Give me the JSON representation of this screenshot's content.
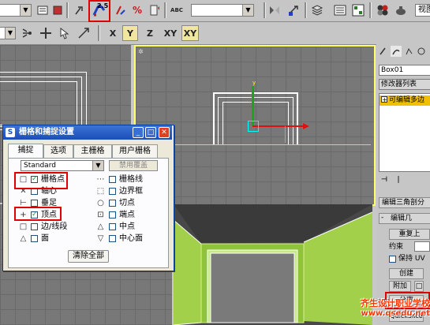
{
  "toolbar1": {
    "view_dropdown": "视图",
    "view_dropdown2": "视图",
    "snap_label": "2.5",
    "angle_snap": "A",
    "percent_snap": "%",
    "abc_label": "ABC"
  },
  "toolbar2": {
    "x_label": "X",
    "y_label": "Y",
    "z_label": "Z",
    "xy_label": "XY",
    "xy2_label": "XY"
  },
  "viewport": {
    "top_left_label": "",
    "perspective_label": ""
  },
  "dialog": {
    "title": "栅格和捕捉设置",
    "tabs": [
      "捕捉",
      "选项",
      "主栅格",
      "用户栅格"
    ],
    "preset": "Standard",
    "override_button": "禁用覆盖",
    "left_options": [
      {
        "label": "栅格点",
        "checked": true
      },
      {
        "label": "轴心",
        "checked": false
      },
      {
        "label": "垂足",
        "checked": false
      },
      {
        "label": "顶点",
        "checked": true
      },
      {
        "label": "边/线段",
        "checked": false
      },
      {
        "label": "面",
        "checked": false
      }
    ],
    "right_options": [
      {
        "label": "栅格线",
        "checked": false
      },
      {
        "label": "边界框",
        "checked": false
      },
      {
        "label": "切点",
        "checked": false
      },
      {
        "label": "端点",
        "checked": false
      },
      {
        "label": "中点",
        "checked": false
      },
      {
        "label": "中心面",
        "checked": false
      }
    ],
    "clear_button": "清除全部"
  },
  "panel": {
    "object_name": "Box01",
    "modifier_list": "修改器列表",
    "modifier_item": "可编辑多边",
    "pin_icon_label": "",
    "rollout1": "编辑三角剖分",
    "rollout2": "编辑几",
    "redo_button": "重复上",
    "constraint_label": "约束",
    "preserve_uv": "保持 UV",
    "create_button": "创建",
    "attach_button": "附加",
    "detach_button": "分离",
    "slice_button": "QuickSlice"
  },
  "watermark": {
    "line1": "齐生设计职业学校",
    "line2": "www.qsedu.net"
  },
  "colors": {
    "highlight_red": "#e00000",
    "active_viewport_border": "#ffff66",
    "dialog_title": "#1b4fb8",
    "watermark_text": "#ff3300"
  }
}
